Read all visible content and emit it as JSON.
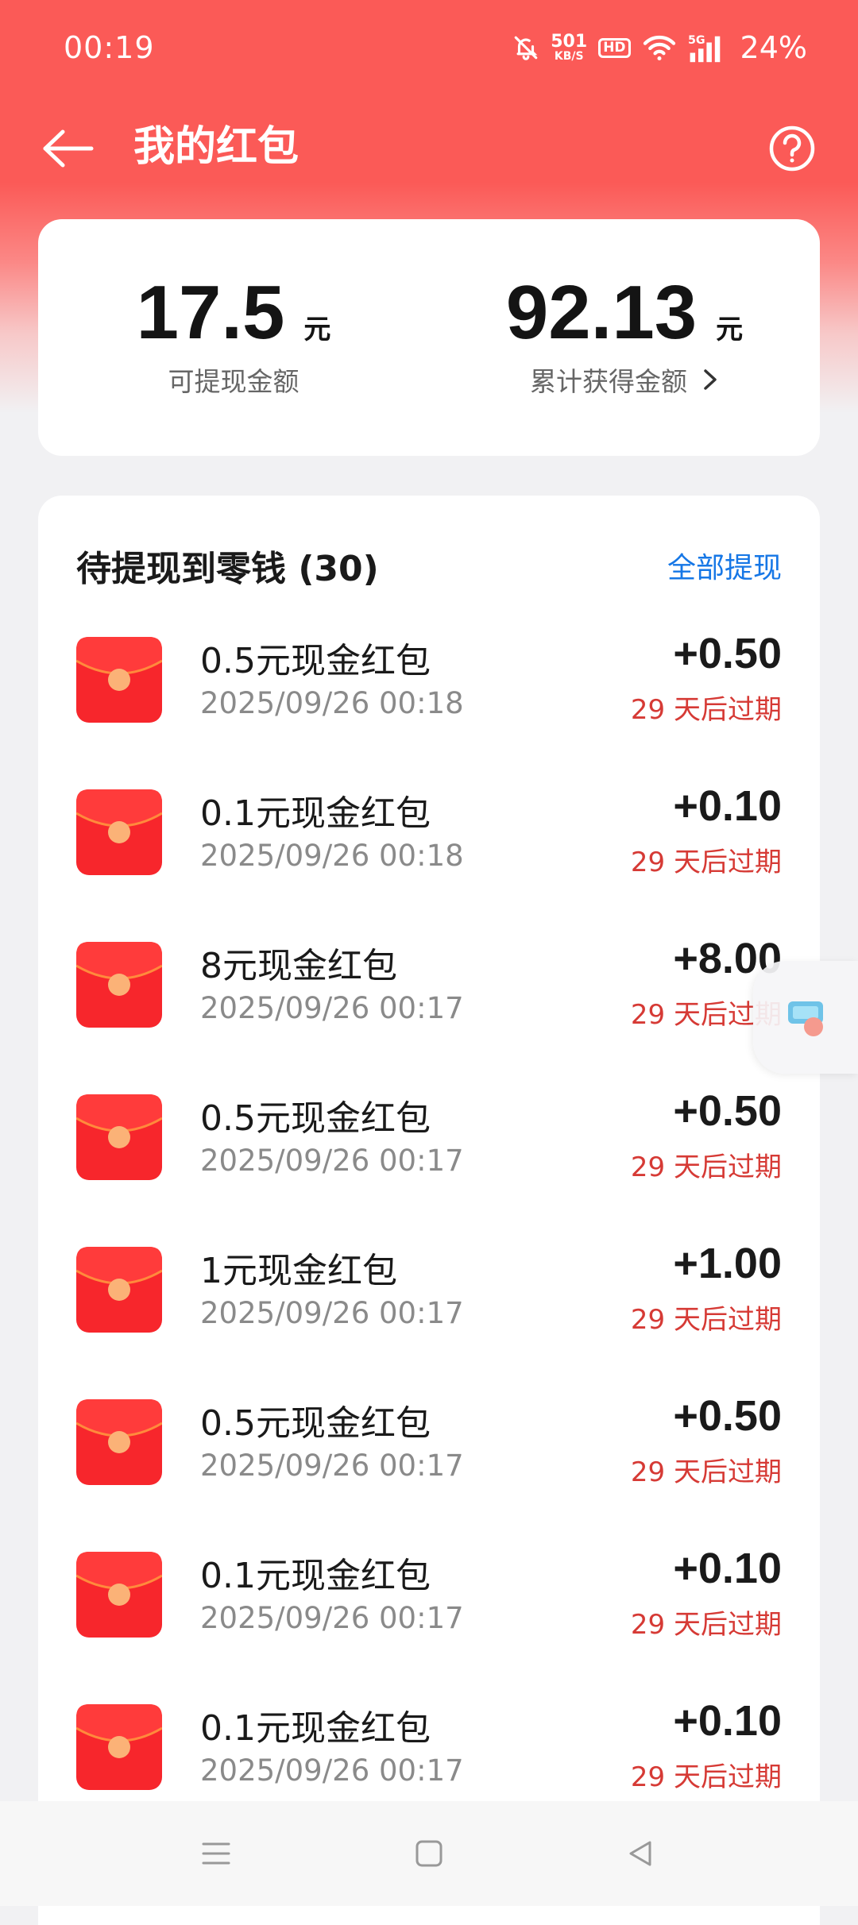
{
  "status_bar": {
    "time": "00:19",
    "net_speed_value": "501",
    "net_speed_unit": "KB/S",
    "hd_label": "HD",
    "network_label": "5G",
    "battery": "24%",
    "icons": [
      "bell-muted-icon",
      "wifi-icon",
      "signal-icon"
    ]
  },
  "header": {
    "title": "我的红包",
    "back_icon": "arrow-left-icon",
    "help_icon": "question-circle-icon"
  },
  "summary": {
    "withdrawable": {
      "value": "17.5",
      "unit": "元",
      "label": "可提现金额"
    },
    "total": {
      "value": "92.13",
      "unit": "元",
      "label": "累计获得金额"
    }
  },
  "pending": {
    "title": "待提现到零钱 (30)",
    "withdraw_all": "全部提现",
    "items": [
      {
        "title": "0.5元现金红包",
        "time": "2025/09/26 00:18",
        "amount": "+0.50",
        "expiry": "29 天后过期"
      },
      {
        "title": "0.1元现金红包",
        "time": "2025/09/26 00:18",
        "amount": "+0.10",
        "expiry": "29 天后过期"
      },
      {
        "title": "8元现金红包",
        "time": "2025/09/26 00:17",
        "amount": "+8.00",
        "expiry": "29 天后过期"
      },
      {
        "title": "0.5元现金红包",
        "time": "2025/09/26 00:17",
        "amount": "+0.50",
        "expiry": "29 天后过期"
      },
      {
        "title": "1元现金红包",
        "time": "2025/09/26 00:17",
        "amount": "+1.00",
        "expiry": "29 天后过期"
      },
      {
        "title": "0.5元现金红包",
        "time": "2025/09/26 00:17",
        "amount": "+0.50",
        "expiry": "29 天后过期"
      },
      {
        "title": "0.1元现金红包",
        "time": "2025/09/26 00:17",
        "amount": "+0.10",
        "expiry": "29 天后过期"
      },
      {
        "title": "0.1元现金红包",
        "time": "2025/09/26 00:17",
        "amount": "+0.10",
        "expiry": "29 天后过期"
      }
    ]
  },
  "colors": {
    "brand_red": "#fb5a57",
    "link_blue": "#1677e6",
    "expiry_red": "#d63a35"
  },
  "nav": {
    "icons": [
      "menu-icon",
      "home-square-icon",
      "back-triangle-icon"
    ]
  }
}
